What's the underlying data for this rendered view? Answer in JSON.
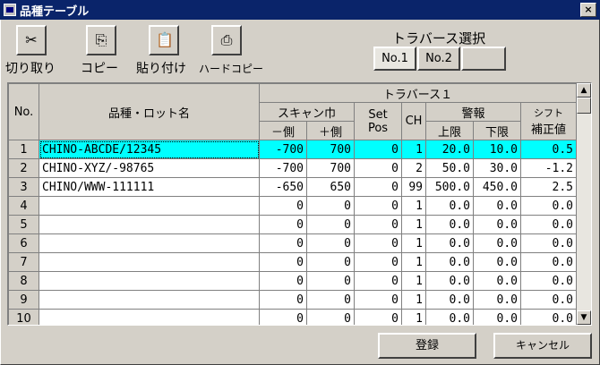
{
  "window": {
    "title": "品種テーブル",
    "close": "×"
  },
  "toolbar": {
    "cut_label": "切り取り",
    "copy_label": "コピー",
    "paste_label": "貼り付け",
    "hardcopy_label": "ハードコピー"
  },
  "traverse_select": {
    "label": "トラバース選択",
    "tabs": [
      "No.1",
      "No.2",
      ""
    ]
  },
  "grid": {
    "headers": {
      "no": "No.",
      "name": "品種・ロット名",
      "traverse": "トラバース１",
      "scan_width": "スキャン巾",
      "minus_side": "－側",
      "plus_side": "＋側",
      "set_pos_1": "Set",
      "set_pos_2": "Pos",
      "ch": "CH",
      "alarm": "警報",
      "upper": "上限",
      "lower": "下限",
      "shift_1": "シフト",
      "shift_2": "補正値"
    },
    "rows": [
      {
        "no": "1",
        "name": "CHINO-ABCDE/12345",
        "minus": "-700",
        "plus": "700",
        "setpos": "0",
        "ch": "1",
        "upper": "20.0",
        "lower": "10.0",
        "shift": "0.5"
      },
      {
        "no": "2",
        "name": "CHINO-XYZ/-98765",
        "minus": "-700",
        "plus": "700",
        "setpos": "0",
        "ch": "2",
        "upper": "50.0",
        "lower": "30.0",
        "shift": "-1.2"
      },
      {
        "no": "3",
        "name": "CHINO/WWW-111111",
        "minus": "-650",
        "plus": "650",
        "setpos": "0",
        "ch": "99",
        "upper": "500.0",
        "lower": "450.0",
        "shift": "2.5"
      },
      {
        "no": "4",
        "name": "",
        "minus": "0",
        "plus": "0",
        "setpos": "0",
        "ch": "1",
        "upper": "0.0",
        "lower": "0.0",
        "shift": "0.0"
      },
      {
        "no": "5",
        "name": "",
        "minus": "0",
        "plus": "0",
        "setpos": "0",
        "ch": "1",
        "upper": "0.0",
        "lower": "0.0",
        "shift": "0.0"
      },
      {
        "no": "6",
        "name": "",
        "minus": "0",
        "plus": "0",
        "setpos": "0",
        "ch": "1",
        "upper": "0.0",
        "lower": "0.0",
        "shift": "0.0"
      },
      {
        "no": "7",
        "name": "",
        "minus": "0",
        "plus": "0",
        "setpos": "0",
        "ch": "1",
        "upper": "0.0",
        "lower": "0.0",
        "shift": "0.0"
      },
      {
        "no": "8",
        "name": "",
        "minus": "0",
        "plus": "0",
        "setpos": "0",
        "ch": "1",
        "upper": "0.0",
        "lower": "0.0",
        "shift": "0.0"
      },
      {
        "no": "9",
        "name": "",
        "minus": "0",
        "plus": "0",
        "setpos": "0",
        "ch": "1",
        "upper": "0.0",
        "lower": "0.0",
        "shift": "0.0"
      },
      {
        "no": "10",
        "name": "",
        "minus": "0",
        "plus": "0",
        "setpos": "0",
        "ch": "1",
        "upper": "0.0",
        "lower": "0.0",
        "shift": "0.0"
      }
    ],
    "selected_row": 1,
    "scroll_up": "▲",
    "scroll_down": "▼"
  },
  "buttons": {
    "register": "登録",
    "cancel": "キャンセル"
  },
  "colors": {
    "title_bar": "#0a246a",
    "face": "#d4d0c8",
    "selection": "#00ffff"
  },
  "icons": {
    "cut": "scissors-icon",
    "copy": "copy-icon",
    "paste": "paste-icon",
    "hardcopy": "printer-icon",
    "window": "window-icon"
  }
}
